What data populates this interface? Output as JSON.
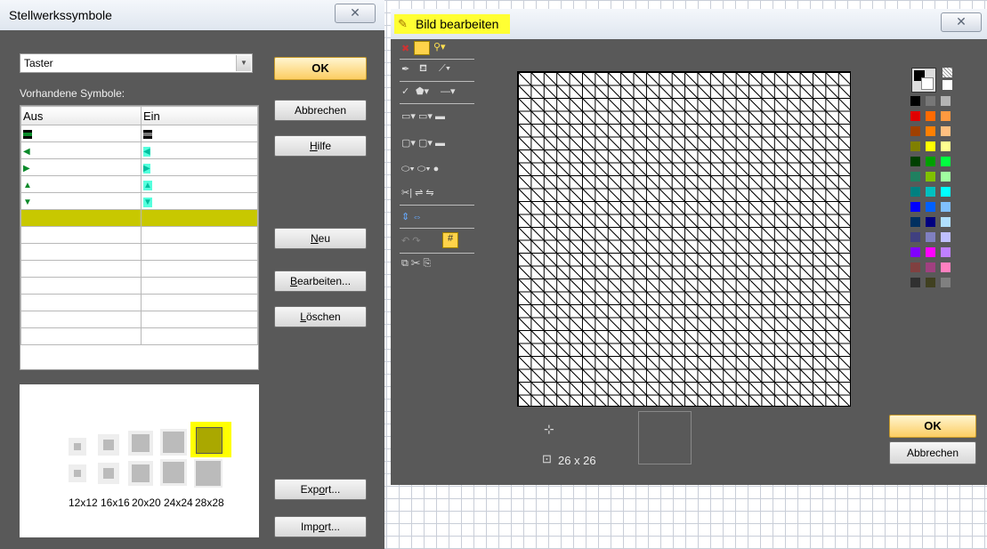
{
  "left_dialog": {
    "title": "Stellwerkssymbole",
    "close_glyph": "✕",
    "type_select": {
      "value": "Taster"
    },
    "available_label": "Vorhandene Symbole:",
    "table": {
      "headers": [
        "Aus",
        "Ein"
      ],
      "rows": [
        {
          "aus_icon": "block-signal-icon",
          "ein_icon": "block-signal-icon"
        },
        {
          "aus_icon": "left-arrow-icon",
          "ein_icon": "left-arrow-icon"
        },
        {
          "aus_icon": "right-arrow-icon",
          "ein_icon": "right-arrow-icon"
        },
        {
          "aus_icon": "up-arrow-icon",
          "ein_icon": "up-arrow-icon"
        },
        {
          "aus_icon": "down-arrow-icon",
          "ein_icon": "down-arrow-icon"
        }
      ]
    },
    "size_labels": [
      "12x12",
      "16x16",
      "20x20",
      "24x24",
      "28x28"
    ],
    "buttons": {
      "ok": "OK",
      "abbrechen": "Abbrechen",
      "hilfe_u": "H",
      "hilfe_rest": "ilfe",
      "neu_u": "N",
      "neu_rest": "eu",
      "bearbeiten_u": "B",
      "bearbeiten_rest": "earbeiten...",
      "loeschen_u": "L",
      "loeschen_rest": "öschen",
      "export_pre": "Exp",
      "export_u": "o",
      "export_rest": "rt...",
      "import_pre": "Imp",
      "import_u": "o",
      "import_rest": "rt..."
    },
    "highlight_color": "#e6e600"
  },
  "right_dialog": {
    "title": "Bild bearbeiten",
    "close_glyph": "✕",
    "title_icon": "pencil-icon",
    "grid": {
      "cells": 26
    },
    "size_text": "26 x 26",
    "buttons": {
      "ok": "OK",
      "abbrechen": "Abbrechen"
    },
    "palette": [
      "#000000",
      "#777777",
      "#b4b4b4",
      "#e00000",
      "#ff6a00",
      "#ff9a40",
      "#a04000",
      "#ff8000",
      "#ffc080",
      "#808000",
      "#ffff00",
      "#ffff90",
      "#004000",
      "#00a000",
      "#00ff40",
      "#208060",
      "#80c000",
      "#a0ffa0",
      "#008080",
      "#00c0c0",
      "#00ffff",
      "#0000ff",
      "#0060ff",
      "#80c0ff",
      "#003060",
      "#000080",
      "#b0e0ff",
      "#404080",
      "#8080c0",
      "#c0c0ff",
      "#8000ff",
      "#ff00ff",
      "#c080ff",
      "#804040",
      "#a04080",
      "#ff80c0",
      "#303030",
      "#404020",
      "#808080"
    ]
  }
}
